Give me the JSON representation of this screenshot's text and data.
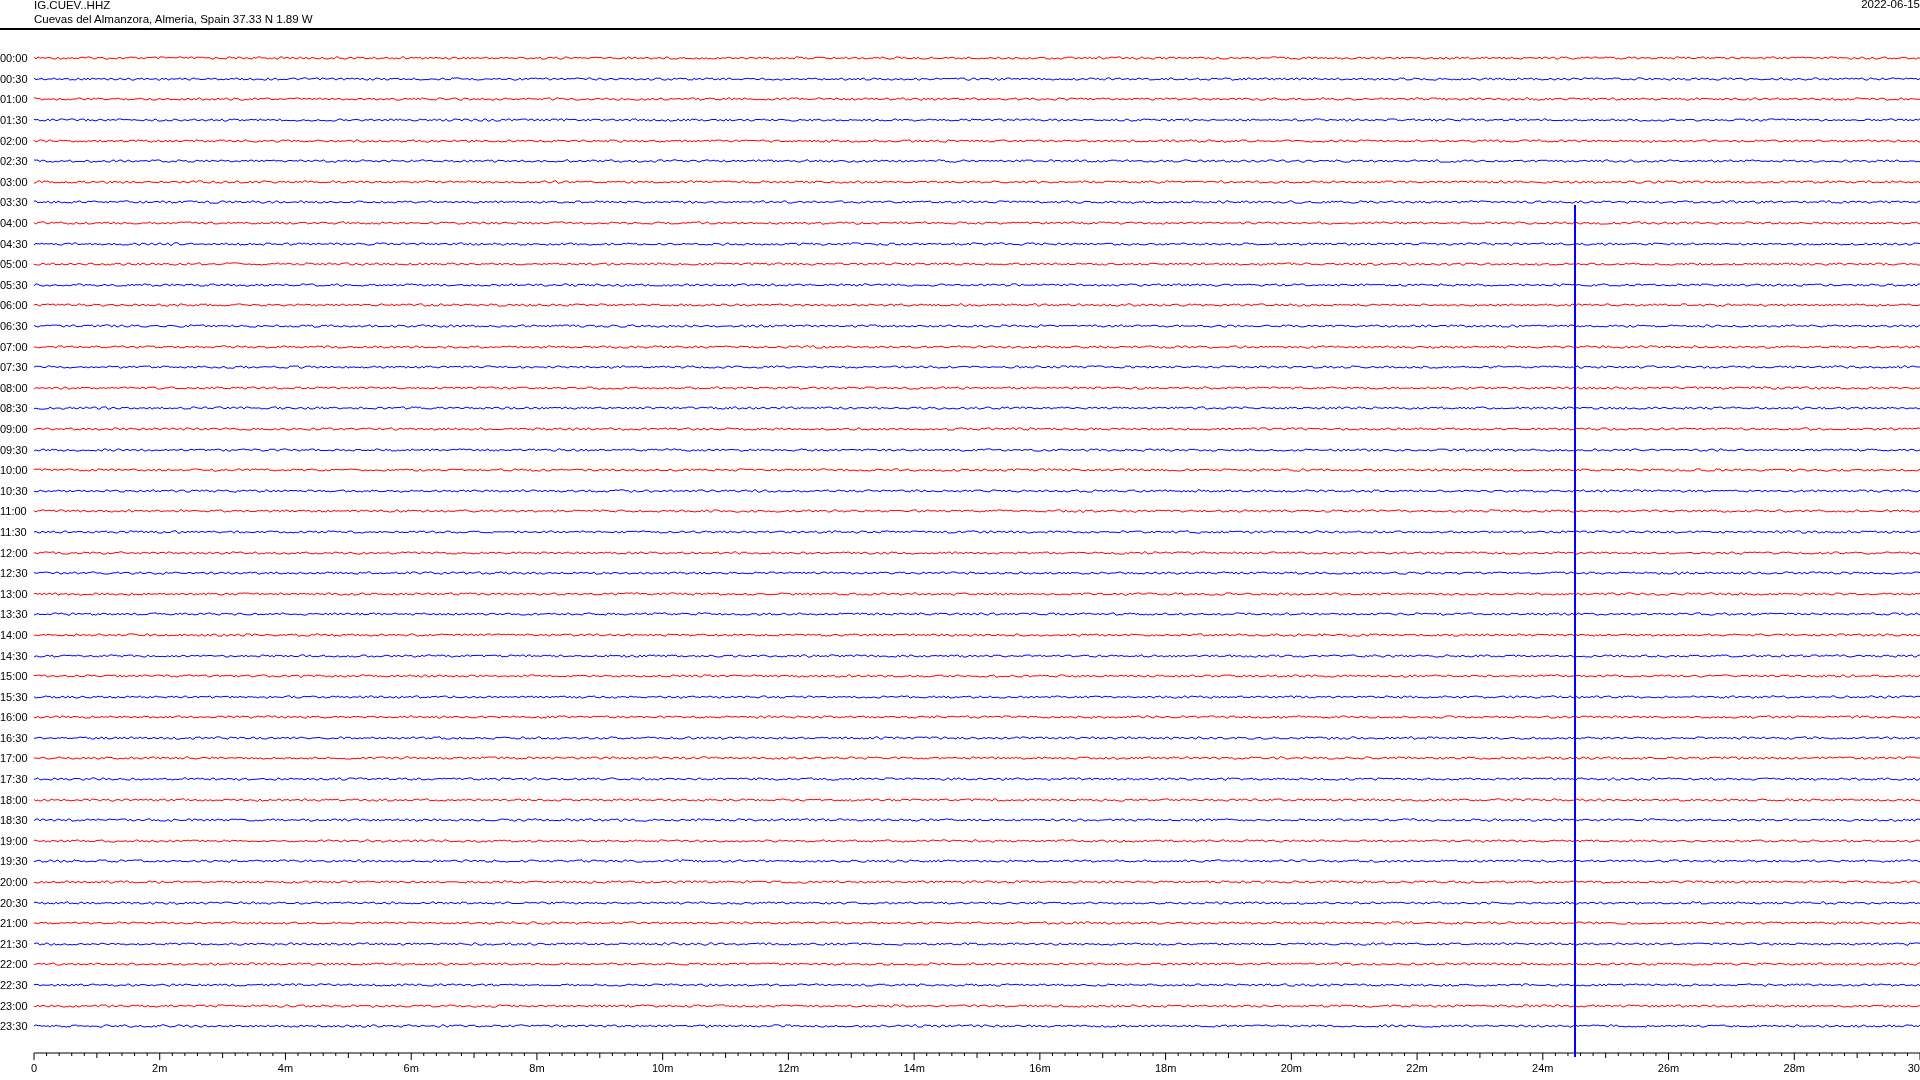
{
  "header": {
    "station": "IG.CUEV..HHZ",
    "location": "Cuevas del Almanzora, Almeria, Spain  37.33 N 1.89 W",
    "date": "2022-06-15"
  },
  "rows": [
    {
      "label": "00:00",
      "color": "#ff0000"
    },
    {
      "label": "00:30",
      "color": "#0000ff"
    },
    {
      "label": "01:00",
      "color": "#ff0000"
    },
    {
      "label": "01:30",
      "color": "#0000ff"
    },
    {
      "label": "02:00",
      "color": "#ff0000"
    },
    {
      "label": "02:30",
      "color": "#0000ff"
    },
    {
      "label": "03:00",
      "color": "#ff0000"
    },
    {
      "label": "03:30",
      "color": "#0000ff"
    },
    {
      "label": "04:00",
      "color": "#ff0000"
    },
    {
      "label": "04:30",
      "color": "#0000ff"
    },
    {
      "label": "05:00",
      "color": "#ff0000"
    },
    {
      "label": "05:30",
      "color": "#0000ff"
    },
    {
      "label": "06:00",
      "color": "#ff0000"
    },
    {
      "label": "06:30",
      "color": "#0000ff"
    },
    {
      "label": "07:00",
      "color": "#ff0000"
    },
    {
      "label": "07:30",
      "color": "#0000ff"
    },
    {
      "label": "08:00",
      "color": "#ff0000"
    },
    {
      "label": "08:30",
      "color": "#0000ff"
    },
    {
      "label": "09:00",
      "color": "#ff0000"
    },
    {
      "label": "09:30",
      "color": "#0000ff"
    },
    {
      "label": "10:00",
      "color": "#ff0000"
    },
    {
      "label": "10:30",
      "color": "#0000ff"
    },
    {
      "label": "11:00",
      "color": "#ff0000"
    },
    {
      "label": "11:30",
      "color": "#0000ff"
    },
    {
      "label": "12:00",
      "color": "#ff0000"
    },
    {
      "label": "12:30",
      "color": "#0000ff"
    },
    {
      "label": "13:00",
      "color": "#ff0000"
    },
    {
      "label": "13:30",
      "color": "#0000ff"
    },
    {
      "label": "14:00",
      "color": "#ff0000"
    },
    {
      "label": "14:30",
      "color": "#0000ff"
    },
    {
      "label": "15:00",
      "color": "#ff0000"
    },
    {
      "label": "15:30",
      "color": "#0000ff"
    },
    {
      "label": "16:00",
      "color": "#ff0000"
    },
    {
      "label": "16:30",
      "color": "#0000ff"
    },
    {
      "label": "17:00",
      "color": "#ff0000"
    },
    {
      "label": "17:30",
      "color": "#0000ff"
    },
    {
      "label": "18:00",
      "color": "#ff0000"
    },
    {
      "label": "18:30",
      "color": "#0000ff"
    },
    {
      "label": "19:00",
      "color": "#ff0000"
    },
    {
      "label": "19:30",
      "color": "#0000ff"
    },
    {
      "label": "20:00",
      "color": "#ff0000"
    },
    {
      "label": "20:30",
      "color": "#0000ff"
    },
    {
      "label": "21:00",
      "color": "#ff0000"
    },
    {
      "label": "21:30",
      "color": "#0000ff"
    },
    {
      "label": "22:00",
      "color": "#ff0000"
    },
    {
      "label": "22:30",
      "color": "#0000ff"
    },
    {
      "label": "23:00",
      "color": "#ff0000"
    },
    {
      "label": "23:30",
      "color": "#0000ff"
    }
  ],
  "x_axis": [
    "0",
    "2m",
    "4m",
    "6m",
    "8m",
    "10m",
    "12m",
    "14m",
    "16m",
    "18m",
    "20m",
    "22m",
    "24m",
    "26m",
    "28m",
    "30"
  ]
}
